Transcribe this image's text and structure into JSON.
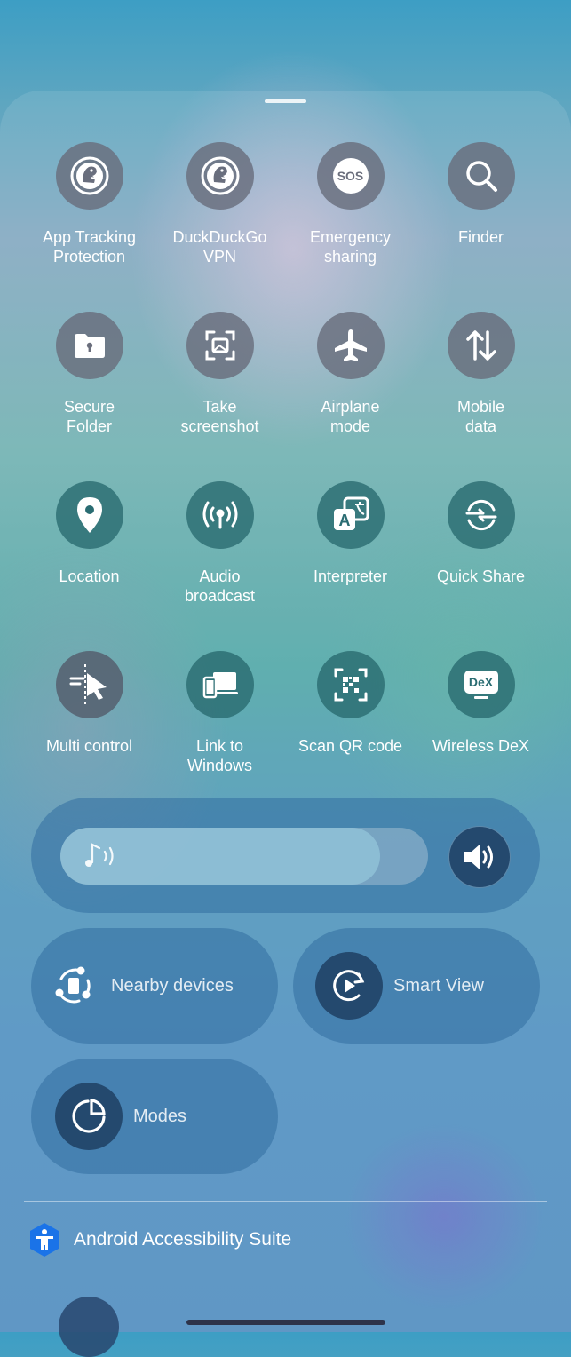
{
  "tiles": [
    {
      "label": "App Tracking\nProtection",
      "icon": "duckduckgo-icon"
    },
    {
      "label": "DuckDuckGo\nVPN",
      "icon": "duckduckgo-vpn-icon"
    },
    {
      "label": "Emergency\nsharing",
      "icon_text": "SOS",
      "icon": "sos-icon"
    },
    {
      "label": "Finder",
      "icon": "search-icon"
    },
    {
      "label": "Secure\nFolder",
      "icon": "secure-folder-icon"
    },
    {
      "label": "Take\nscreenshot",
      "icon": "screenshot-icon"
    },
    {
      "label": "Airplane\nmode",
      "icon": "airplane-icon"
    },
    {
      "label": "Mobile\ndata",
      "icon": "mobile-data-icon"
    },
    {
      "label": "Location",
      "icon": "location-pin-icon"
    },
    {
      "label": "Audio\nbroadcast",
      "icon": "broadcast-icon"
    },
    {
      "label": "Interpreter",
      "icon_text": "A",
      "icon": "interpreter-icon"
    },
    {
      "label": "Quick Share",
      "icon": "quick-share-icon"
    },
    {
      "label": "Multi control",
      "icon": "multi-control-icon"
    },
    {
      "label": "Link to\nWindows",
      "icon": "link-to-windows-icon"
    },
    {
      "label": "Scan QR code",
      "icon": "qr-code-icon"
    },
    {
      "label": "Wireless DeX",
      "icon_text": "DeX",
      "icon": "dex-icon"
    }
  ],
  "volume": {
    "level": 0.87,
    "icon": "music-note-icon",
    "button_icon": "speaker-icon"
  },
  "pills": {
    "nearby": {
      "label": "Nearby devices",
      "icon": "nearby-devices-icon"
    },
    "smart_view": {
      "label": "Smart View",
      "icon": "smart-view-icon"
    },
    "modes": {
      "label": "Modes",
      "icon": "modes-icon"
    }
  },
  "accessibility": {
    "label": "Android Accessibility Suite",
    "icon": "accessibility-icon"
  }
}
